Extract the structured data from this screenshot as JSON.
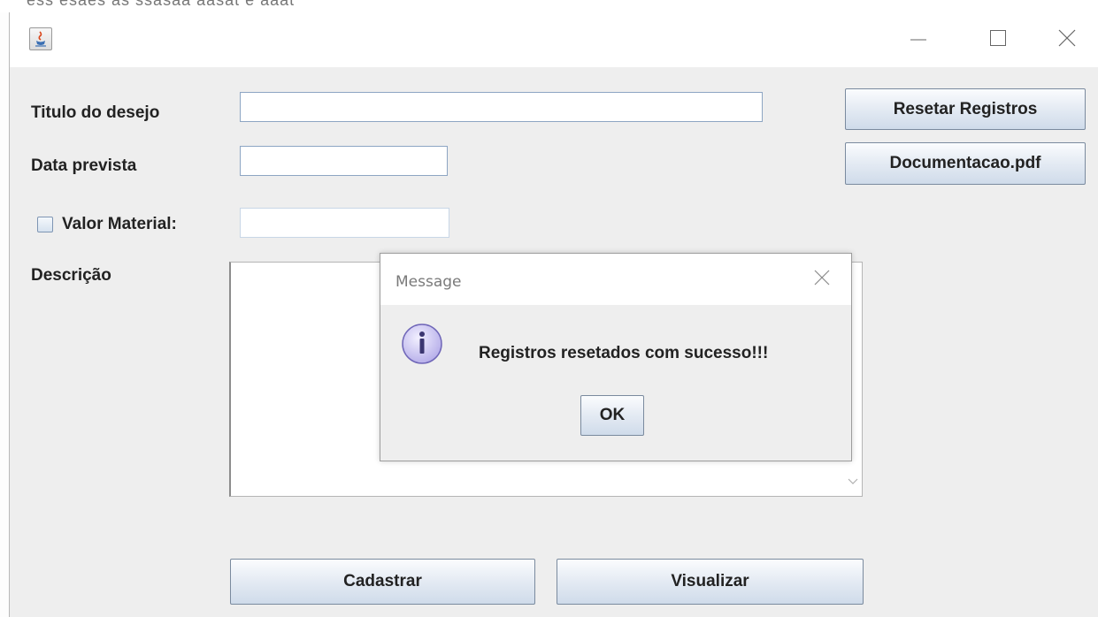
{
  "background_scrap": {
    "text": "ess esaes as ssasaa aasat e aaat"
  },
  "window": {
    "app_icon": "java-cup-icon",
    "controls": [
      "minimize-icon",
      "maximize-icon",
      "close-icon"
    ]
  },
  "form": {
    "titulo_label": "Titulo do desejo",
    "titulo_value": "",
    "data_label": "Data prevista",
    "data_value": "",
    "valor_label": "Valor Material:",
    "valor_checked": false,
    "valor_value": "",
    "descricao_label": "Descrição",
    "descricao_value": ""
  },
  "buttons": {
    "resetar": "Resetar Registros",
    "documentacao": "Documentacao.pdf",
    "cadastrar": "Cadastrar",
    "visualizar": "Visualizar"
  },
  "dialog": {
    "title": "Message",
    "icon": "info-icon",
    "message": "Registros resetados com sucesso!!!",
    "ok": "OK"
  },
  "colors": {
    "window_bg": "#eeeeee",
    "field_border": "#8da5c3",
    "button_gradient_top": "#fbfcfe",
    "button_gradient_bottom": "#cfdbea",
    "info_icon": "#b8b0ea"
  }
}
